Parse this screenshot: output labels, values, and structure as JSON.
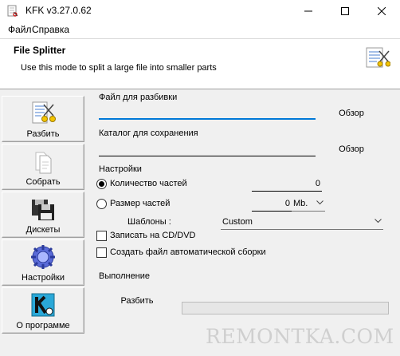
{
  "window": {
    "title": "KFK v3.27.0.62"
  },
  "menu": {
    "file": "Файл",
    "help": "Справка"
  },
  "header": {
    "title": "File Splitter",
    "description": "Use this mode to split a large file into smaller parts",
    "icon": "scissors-file-icon"
  },
  "sidebar": {
    "items": [
      {
        "label": "Разбить",
        "icon": "split-scissors-icon"
      },
      {
        "label": "Собрать",
        "icon": "assemble-pages-icon"
      },
      {
        "label": "Дискеты",
        "icon": "floppy-disk-icon"
      },
      {
        "label": "Настройки",
        "icon": "settings-gear-icon"
      },
      {
        "label": "О программе",
        "icon": "about-logo-icon"
      }
    ]
  },
  "form": {
    "file_label": "Файл для разбивки",
    "file_value": "",
    "browse1": "Обзор",
    "folder_label": "Каталог для сохранения",
    "folder_value": "",
    "browse2": "Обзор",
    "settings_label": "Настройки",
    "parts_count_label": "Количество частей",
    "parts_count_value": "0",
    "parts_count_selected": true,
    "part_size_label": "Размер частей",
    "part_size_value": "0",
    "part_size_unit": "Mb.",
    "templates_label": "Шаблоны :",
    "templates_value": "Custom",
    "cd_label": "Записать на CD/DVD",
    "cd_checked": false,
    "auto_label": "Создать файл автоматической сборки",
    "auto_checked": false,
    "execution_label": "Выполнение",
    "split_button": "Разбить",
    "progress": 0
  },
  "colors": {
    "focus_underline": "#0078d7",
    "window_bg": "#f0f0f0",
    "header_bg": "#ffffff"
  },
  "watermark": "REMONTKA.COM"
}
